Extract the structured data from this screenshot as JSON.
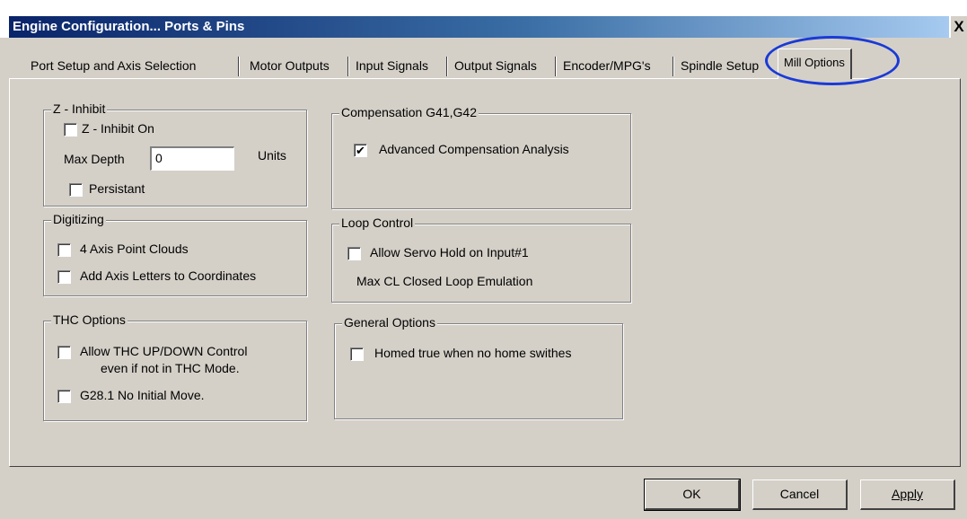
{
  "window": {
    "title": "Engine Configuration... Ports & Pins",
    "close_label": "X"
  },
  "tabs": [
    {
      "label": "Port Setup and Axis Selection"
    },
    {
      "label": "Motor Outputs"
    },
    {
      "label": "Input Signals"
    },
    {
      "label": "Output Signals"
    },
    {
      "label": "Encoder/MPG's"
    },
    {
      "label": "Spindle Setup"
    },
    {
      "label": "Mill Options",
      "active": true
    }
  ],
  "z_inhibit": {
    "legend": "Z - Inhibit",
    "inhibit_on_label": "Z - Inhibit On",
    "inhibit_on_checked": false,
    "max_depth_label": "Max Depth",
    "max_depth_value": "0",
    "units_label": "Units",
    "persistant_label": "Persistant",
    "persistant_checked": false
  },
  "digitizing": {
    "legend": "Digitizing",
    "point_clouds_label": "4 Axis Point Clouds",
    "point_clouds_checked": false,
    "axis_letters_label": "Add Axis Letters to Coordinates",
    "axis_letters_checked": false
  },
  "thc": {
    "legend": "THC Options",
    "updown_label_1": "Allow THC UP/DOWN Control",
    "updown_label_2": "even if not in THC Mode.",
    "updown_checked": false,
    "g28_label": "G28.1 No Initial Move.",
    "g28_checked": false
  },
  "compensation": {
    "legend": "Compensation G41,G42",
    "advanced_label": "Advanced Compensation Analysis",
    "advanced_checked": true
  },
  "loop_control": {
    "legend": "Loop Control",
    "servo_hold_label": "Allow Servo Hold on Input#1",
    "servo_hold_checked": false,
    "max_cl_label": "Max CL Closed Loop Emulation"
  },
  "general": {
    "legend": "General Options",
    "homed_label": "Homed true when no home swithes",
    "homed_checked": false
  },
  "buttons": {
    "ok": "OK",
    "cancel": "Cancel",
    "apply": "Apply"
  },
  "icons": {
    "check_glyph": "✔"
  },
  "colors": {
    "dialog_face": "#d4d0c8",
    "title_bar_start": "#0a246a",
    "highlight_oval": "#1a3ad6"
  }
}
